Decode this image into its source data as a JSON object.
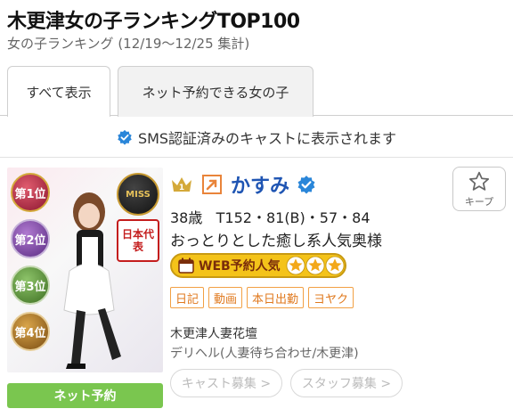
{
  "header": {
    "title": "木更津女の子ランキングTOP100",
    "subtitle": "女の子ランキング (12/19〜12/25 集計)"
  },
  "tabs": [
    {
      "label": "すべて表示",
      "active": true
    },
    {
      "label": "ネット予約できる女の子",
      "active": false
    }
  ],
  "notice": {
    "text": "SMS認証済みのキャストに表示されます",
    "icon": "verified-check-icon"
  },
  "card": {
    "rank": 1,
    "name": "かすみ",
    "verified": true,
    "age": "38歳",
    "measurements": "T152・81(B)・57・84",
    "catchphrase": "おっとりとした癒し系人気奥様",
    "web_badge": {
      "label": "WEB予約人気",
      "stars": 3
    },
    "tags": [
      "日記",
      "動画",
      "本日出勤",
      "ヨヤク"
    ],
    "shop_name": "木更津人妻花壇",
    "shop_type": "デリヘル(人妻待ち合わせ/木更津)",
    "recruit_cast": "キャスト募集 >",
    "recruit_staff": "スタッフ募集 >",
    "net_reserve": "ネット予約",
    "keep_label": "キープ",
    "photo": {
      "badges_left": [
        "第1位",
        "第2位",
        "第3位",
        "第4位"
      ],
      "badge_miss": "MISS",
      "badge_japan": "日本代表"
    }
  },
  "colors": {
    "name": "#1f55b3",
    "tag": "#e0791e",
    "net_reserve": "#7ac64f",
    "web_badge": "#f4c31a",
    "verified": "#2a86d9",
    "crown": "#d4a93a"
  }
}
